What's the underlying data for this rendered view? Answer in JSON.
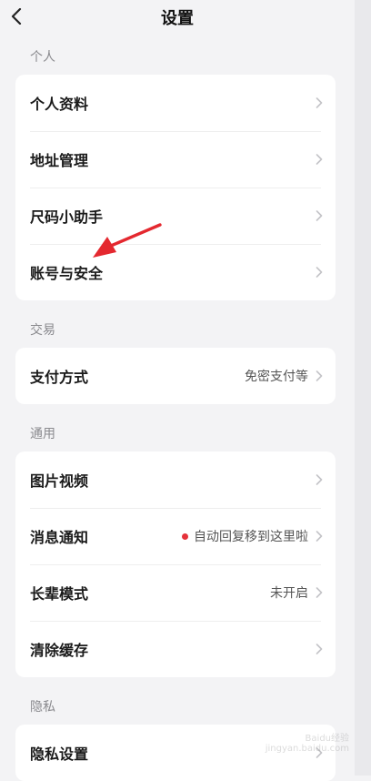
{
  "header": {
    "title": "设置"
  },
  "sections": [
    {
      "label": "个人",
      "items": [
        {
          "label": "个人资料"
        },
        {
          "label": "地址管理"
        },
        {
          "label": "尺码小助手"
        },
        {
          "label": "账号与安全"
        }
      ]
    },
    {
      "label": "交易",
      "items": [
        {
          "label": "支付方式",
          "value": "免密支付等"
        }
      ]
    },
    {
      "label": "通用",
      "items": [
        {
          "label": "图片视频"
        },
        {
          "label": "消息通知",
          "value": "自动回复移到这里啦"
        },
        {
          "label": "长辈模式",
          "value": "未开启"
        },
        {
          "label": "清除缓存"
        }
      ]
    },
    {
      "label": "隐私",
      "items": [
        {
          "label": "隐私设置"
        }
      ]
    }
  ],
  "annotation": {
    "arrow_color": "#e4282f"
  },
  "colors": {
    "background": "#f3f3f5",
    "card": "#ffffff",
    "badge_dot": "#e5323a"
  },
  "watermark": {
    "brand": "Baidu经验",
    "url": "jingyan.baidu.com"
  }
}
